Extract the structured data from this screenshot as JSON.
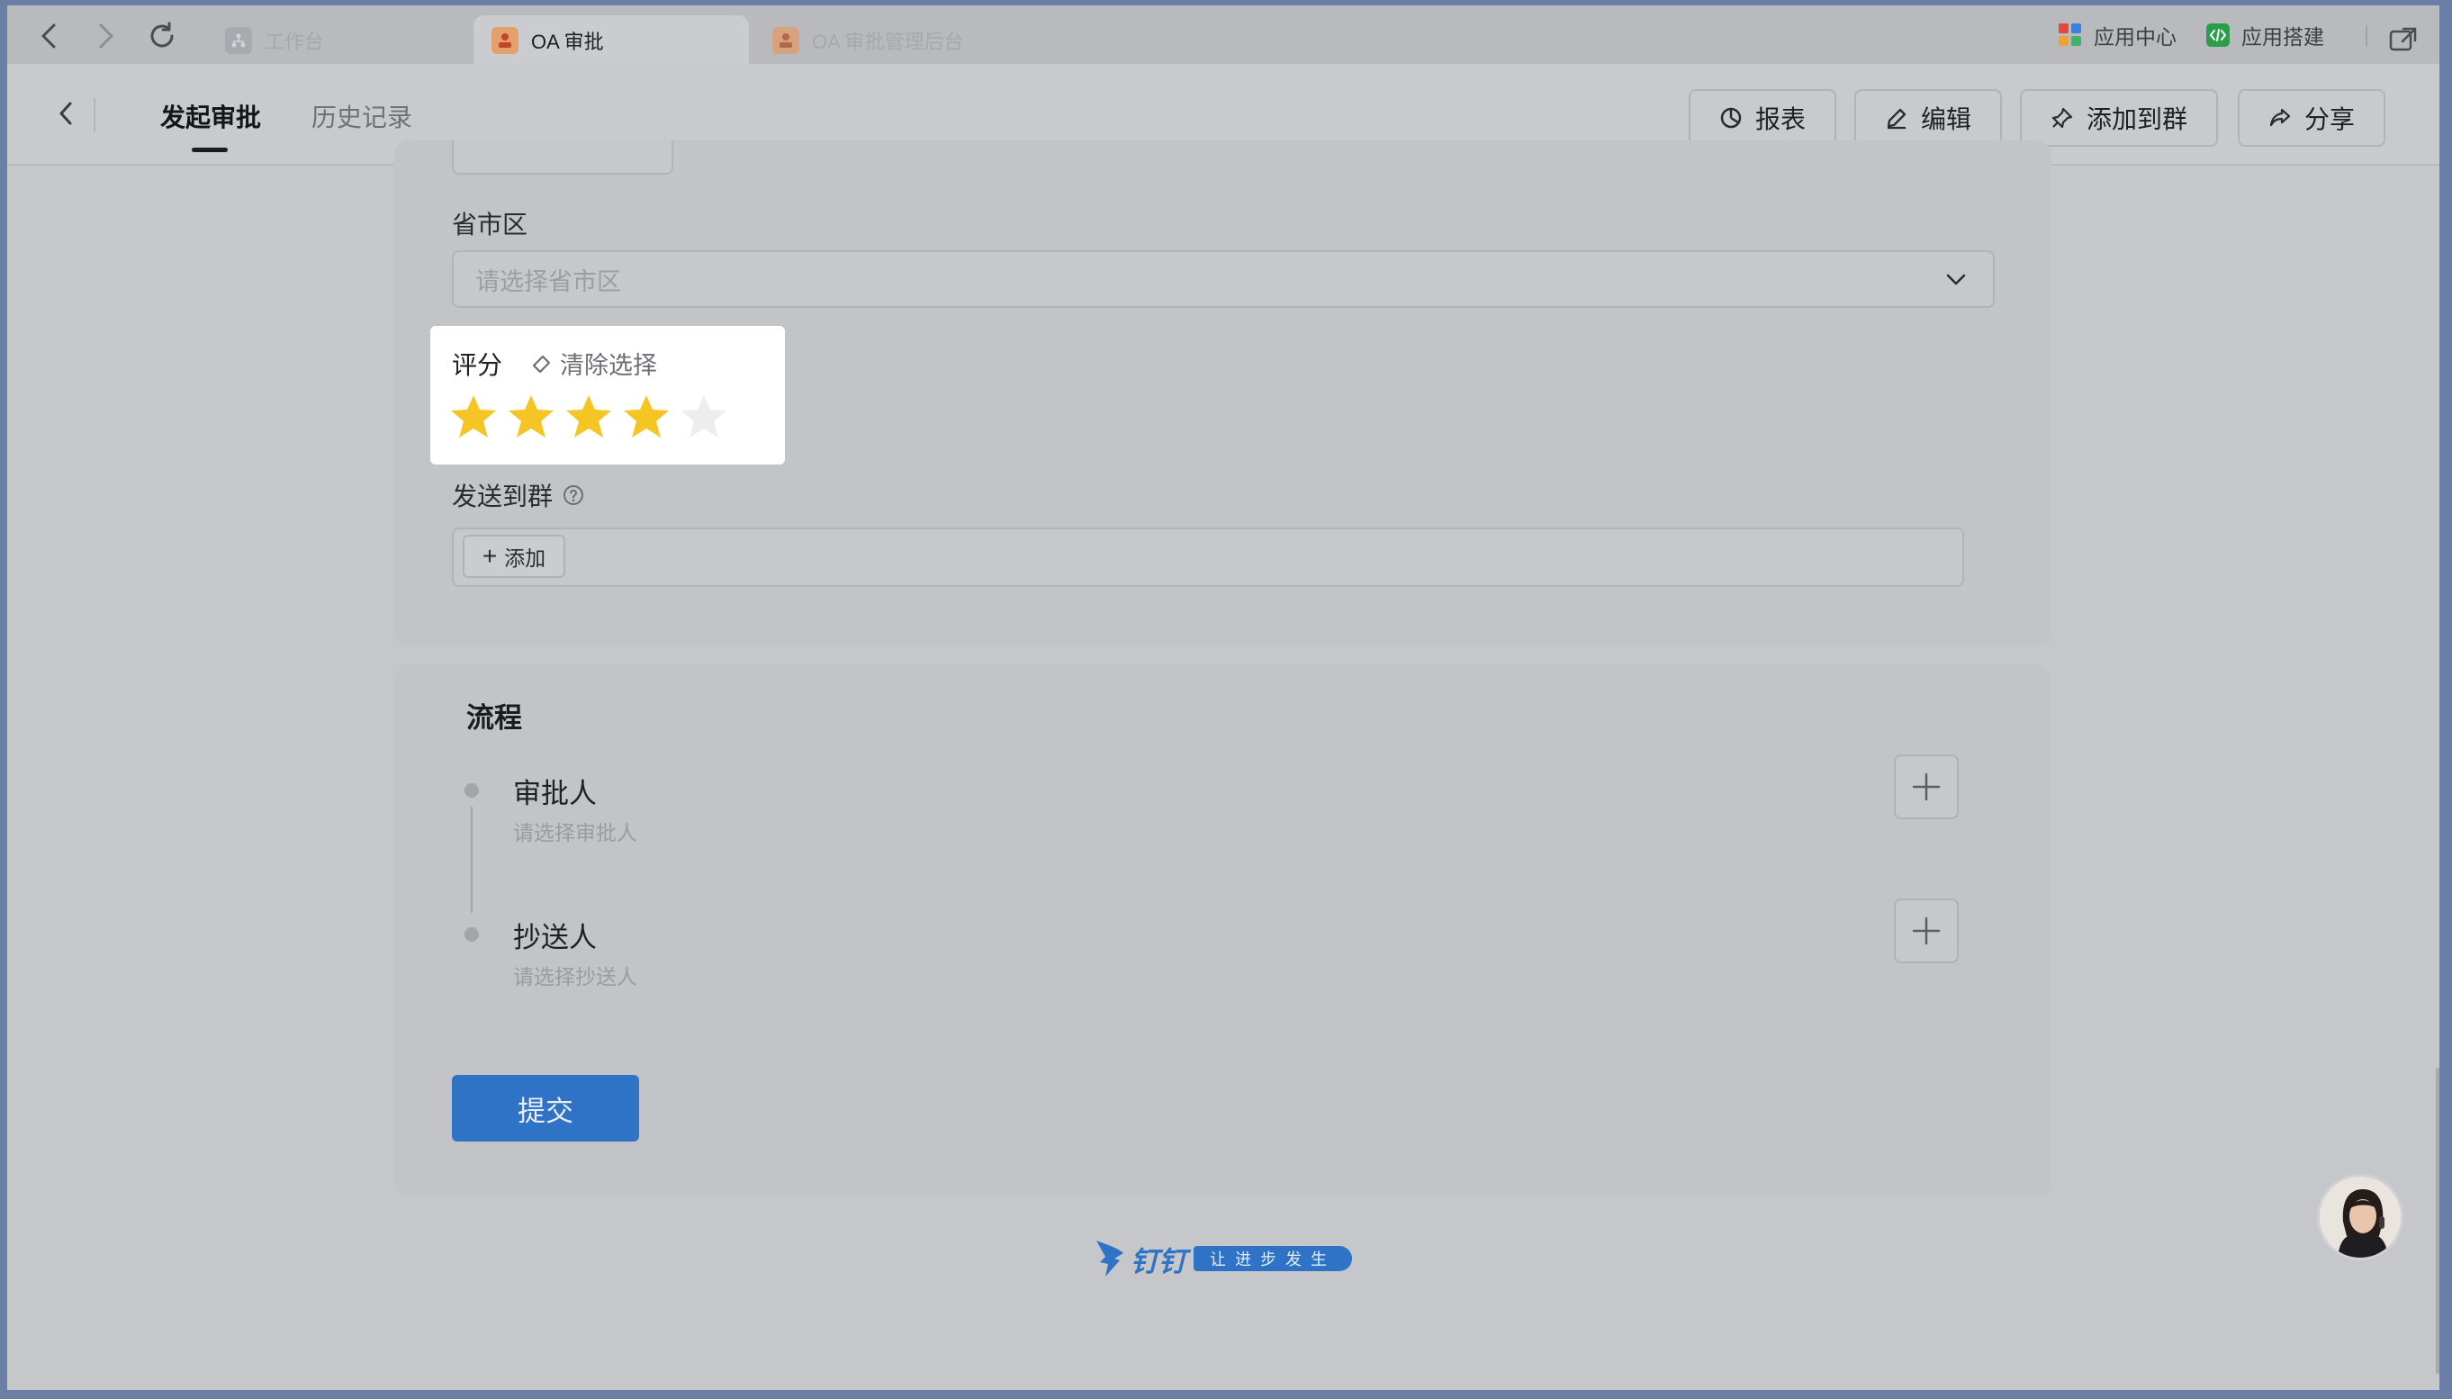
{
  "browser": {
    "tabs": [
      {
        "label": "工作台",
        "active": false
      },
      {
        "label": "OA 审批",
        "active": true
      },
      {
        "label": "OA 审批管理后台",
        "active": false
      }
    ],
    "right_items": [
      {
        "label": "应用中心"
      },
      {
        "label": "应用搭建"
      }
    ]
  },
  "header": {
    "tabs": [
      {
        "label": "发起审批",
        "active": true
      },
      {
        "label": "历史记录",
        "active": false
      }
    ],
    "buttons": {
      "report": "报表",
      "edit": "编辑",
      "add_to_group": "添加到群",
      "share": "分享"
    }
  },
  "form": {
    "region": {
      "label": "省市区",
      "placeholder": "请选择省市区"
    },
    "rating": {
      "label": "评分",
      "clear_label": "清除选择",
      "value": 4,
      "max": 5,
      "star_color": "#f5c623"
    },
    "send_to_group": {
      "label": "发送到群",
      "add_label": "添加"
    }
  },
  "flow": {
    "title": "流程",
    "steps": [
      {
        "name": "审批人",
        "hint": "请选择审批人"
      },
      {
        "name": "抄送人",
        "hint": "请选择抄送人"
      }
    ],
    "submit_label": "提交"
  },
  "footer": {
    "brand": "钉钉",
    "slogan": "让进步发生"
  },
  "colors": {
    "accent": "#2f73c6",
    "star": "#f5c623"
  }
}
